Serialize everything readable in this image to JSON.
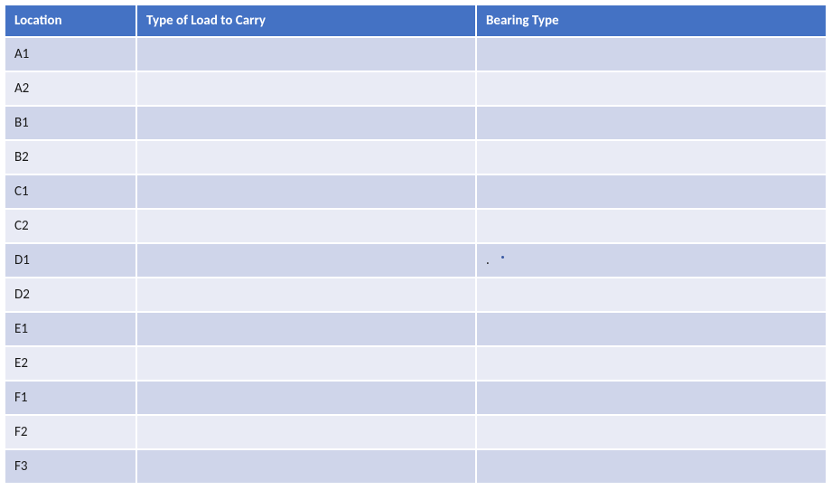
{
  "table": {
    "headers": {
      "location": "Location",
      "load": "Type of Load to Carry",
      "bearing": "Bearing Type"
    },
    "rows": [
      {
        "location": "A1",
        "load": "",
        "bearing": ""
      },
      {
        "location": "A2",
        "load": "",
        "bearing": ""
      },
      {
        "location": "B1",
        "load": "",
        "bearing": ""
      },
      {
        "location": "B2",
        "load": "",
        "bearing": ""
      },
      {
        "location": "C1",
        "load": "",
        "bearing": ""
      },
      {
        "location": "C2",
        "load": "",
        "bearing": ""
      },
      {
        "location": "D1",
        "load": "",
        "bearing": "."
      },
      {
        "location": "D2",
        "load": "",
        "bearing": ""
      },
      {
        "location": "E1",
        "load": "",
        "bearing": ""
      },
      {
        "location": "E2",
        "load": "",
        "bearing": ""
      },
      {
        "location": "F1",
        "load": "",
        "bearing": ""
      },
      {
        "location": "F2",
        "load": "",
        "bearing": ""
      },
      {
        "location": "F3",
        "load": "",
        "bearing": ""
      }
    ]
  }
}
